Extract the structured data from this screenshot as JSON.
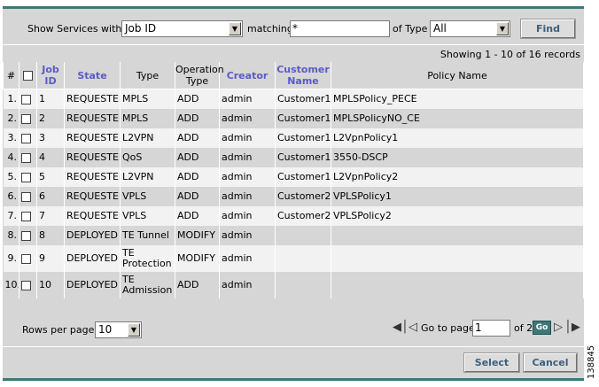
{
  "filter": {
    "show_label": "Show Services with",
    "field_value": "Job ID",
    "matching_label": "matching",
    "matching_value": "*",
    "type_label": "of Type",
    "type_value": "All",
    "find_label": "Find"
  },
  "records_text": "Showing 1 - 10 of 16 records",
  "columns": {
    "num": "#",
    "job_id": "Job ID",
    "state": "State",
    "type": "Type",
    "operation": "Operation Type",
    "creator": "Creator",
    "customer": "Customer Name",
    "policy": "Policy Name"
  },
  "rows": [
    {
      "num": "1.",
      "job": "1",
      "state": "REQUESTED",
      "type": "MPLS",
      "op": "ADD",
      "creator": "admin",
      "customer": "Customer1",
      "policy": "MPLSPolicy_PECE"
    },
    {
      "num": "2.",
      "job": "2",
      "state": "REQUESTED",
      "type": "MPLS",
      "op": "ADD",
      "creator": "admin",
      "customer": "Customer1",
      "policy": "MPLSPolicyNO_CE"
    },
    {
      "num": "3.",
      "job": "3",
      "state": "REQUESTED",
      "type": "L2VPN",
      "op": "ADD",
      "creator": "admin",
      "customer": "Customer1",
      "policy": "L2VpnPolicy1"
    },
    {
      "num": "4.",
      "job": "4",
      "state": "REQUESTED",
      "type": "QoS",
      "op": "ADD",
      "creator": "admin",
      "customer": "Customer1",
      "policy": "3550-DSCP"
    },
    {
      "num": "5.",
      "job": "5",
      "state": "REQUESTED",
      "type": "L2VPN",
      "op": "ADD",
      "creator": "admin",
      "customer": "Customer1",
      "policy": "L2VpnPolicy2"
    },
    {
      "num": "6.",
      "job": "6",
      "state": "REQUESTED",
      "type": "VPLS",
      "op": "ADD",
      "creator": "admin",
      "customer": "Customer2",
      "policy": "VPLSPolicy1"
    },
    {
      "num": "7.",
      "job": "7",
      "state": "REQUESTED",
      "type": "VPLS",
      "op": "ADD",
      "creator": "admin",
      "customer": "Customer2",
      "policy": "VPLSPolicy2"
    },
    {
      "num": "8.",
      "job": "8",
      "state": "DEPLOYED",
      "type": "TE Tunnel",
      "op": "MODIFY",
      "creator": "admin",
      "customer": "",
      "policy": ""
    },
    {
      "num": "9.",
      "job": "9",
      "state": "DEPLOYED",
      "type": "TE Protection",
      "op": "MODIFY",
      "creator": "admin",
      "customer": "",
      "policy": ""
    },
    {
      "num": "10.",
      "job": "10",
      "state": "DEPLOYED",
      "type": "TE Admission",
      "op": "ADD",
      "creator": "admin",
      "customer": "",
      "policy": ""
    }
  ],
  "pagination": {
    "rows_label": "Rows per page:",
    "rows_value": "10",
    "goto_label": "Go to page:",
    "page_value": "1",
    "of_label": "of 2",
    "go_label": "Go"
  },
  "actions": {
    "select_label": "Select",
    "cancel_label": "Cancel"
  },
  "watermark": "138845",
  "colors": {
    "panel": "#d6d6d6",
    "accent": "#3f7777",
    "header_link": "#5b5bc7",
    "button_text": "#3d5f7a"
  }
}
